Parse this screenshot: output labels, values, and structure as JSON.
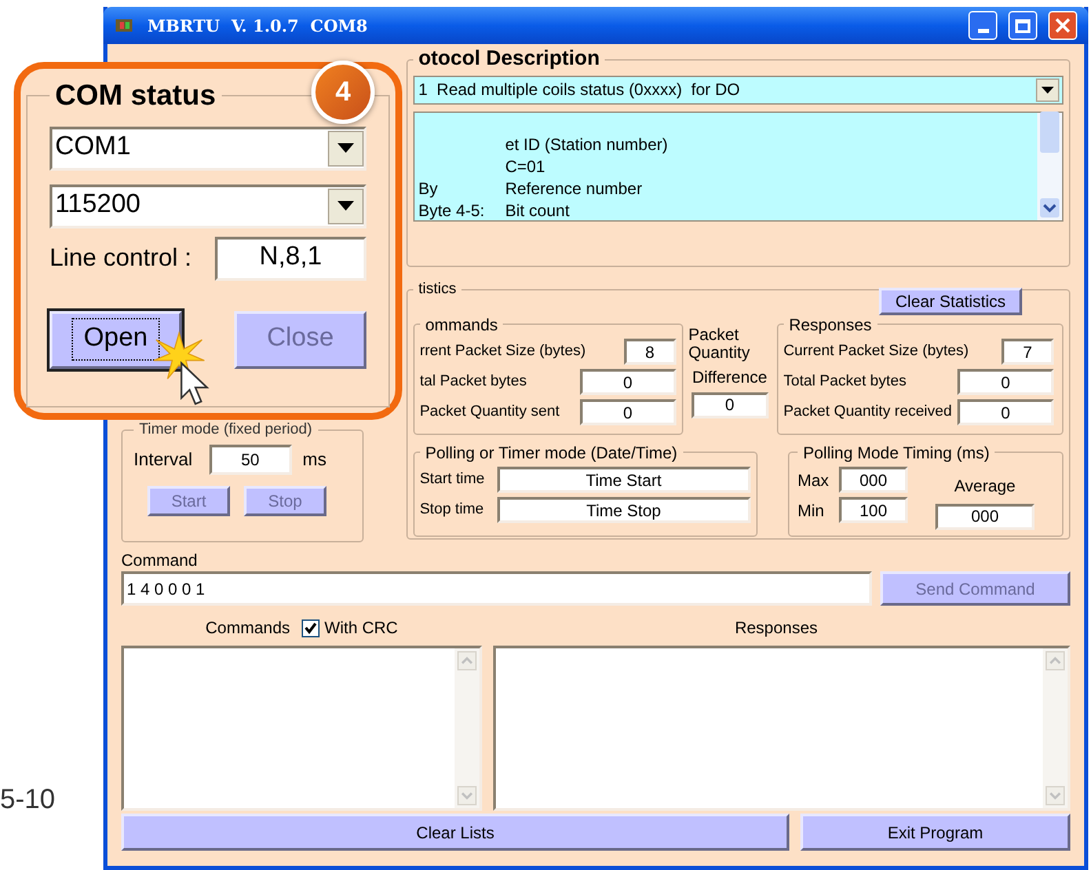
{
  "page_number": "5-10",
  "window": {
    "title": "MBRTU  V. 1.0.7  COM8"
  },
  "com_status": {
    "title": "COM status",
    "port": "COM1",
    "baud": "115200",
    "line_control_label": "Line control :",
    "line_control": "N,8,1",
    "buttons": [
      {
        "label": "Open",
        "disabled": false,
        "focused": true
      },
      {
        "label": "Close",
        "disabled": true,
        "focused": false
      }
    ]
  },
  "step_badge": "4",
  "protocol": {
    "title": "otocol Description",
    "function": "1  Read multiple coils status (0xxxx)  for DO",
    "lines": [
      {
        "meaning": "et ID (Station number)"
      },
      {
        "meaning": "C=01"
      },
      {
        "field": "By",
        "meaning": "Reference number"
      },
      {
        "field": "Byte 4-5:",
        "meaning": "Bit count"
      }
    ]
  },
  "statistics": {
    "title": "tistics",
    "clear_button": "Clear Statistics",
    "commands": {
      "title": "ommands",
      "rows": [
        {
          "label": "rrent Packet Size (bytes)",
          "value": "8"
        },
        {
          "label": "tal Packet bytes",
          "value": "0"
        },
        {
          "label": "Packet Quantity sent",
          "value": "0"
        }
      ]
    },
    "difference": {
      "label_1": "Packet Quantity",
      "label_2": "Difference",
      "value": "0"
    },
    "responses": {
      "title": "Responses",
      "rows": [
        {
          "label": "Current Packet Size (bytes)",
          "value": "7"
        },
        {
          "label": "Total Packet bytes",
          "value": "0"
        },
        {
          "label": "Packet Quantity received",
          "value": "0"
        }
      ]
    },
    "polling": {
      "title": "Polling  or Timer mode  (Date/Time)",
      "rows": [
        {
          "label": "Start time",
          "value": "Time Start"
        },
        {
          "label": "Stop time",
          "value": "Time Stop"
        }
      ]
    },
    "timing": {
      "title": "Polling Mode Timing (ms)",
      "max_label": "Max",
      "max": "000",
      "min_label": "Min",
      "min": "100",
      "average_label": "Average",
      "average": "000"
    }
  },
  "timer": {
    "title": "Timer mode (fixed period)",
    "interval_label": "Interval",
    "interval": "50",
    "unit": "ms",
    "buttons": [
      {
        "label": "Start",
        "disabled": true
      },
      {
        "label": "Stop",
        "disabled": true
      }
    ]
  },
  "command": {
    "label": "Command",
    "value": "1 4 0 0 0 1",
    "send_button": {
      "label": "Send Command",
      "disabled": true
    }
  },
  "lists": {
    "commands_label": "Commands",
    "with_crc": {
      "label": "With CRC",
      "checked": true
    },
    "responses_label": "Responses"
  },
  "buttons": [
    "Clear Lists",
    "Exit Program"
  ]
}
